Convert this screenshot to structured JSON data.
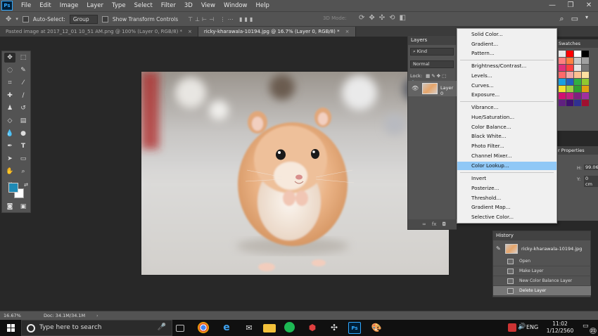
{
  "app": {
    "logo": "Ps"
  },
  "menubar": {
    "items": [
      "File",
      "Edit",
      "Image",
      "Layer",
      "Type",
      "Select",
      "Filter",
      "3D",
      "View",
      "Window",
      "Help"
    ],
    "window_controls": [
      "—",
      "❐",
      "✕"
    ]
  },
  "options": {
    "auto_select_label": "Auto-Select:",
    "auto_select_value": "Group",
    "transform_label": "Show Transform Controls",
    "mode_3d_label": "3D Mode:"
  },
  "tabs": [
    {
      "label": "Pasted image at 2017_12_01 10_51 AM.png @ 100% (Layer 0, RGB/8) *",
      "close": "×"
    },
    {
      "label": "ricky-kharawala-10194.jpg @ 16.7% (Layer 0, RGB/8) *",
      "close": "×"
    }
  ],
  "layers": {
    "title": "Layers",
    "filter_label": "Kind",
    "blend_mode": "Normal",
    "lock_label": "Lock:",
    "layer_name": "Layer 0",
    "footer_icons": [
      "∞",
      "fx",
      "◘"
    ]
  },
  "adjustment_menu": {
    "items": [
      "Solid Color...",
      "Gradient...",
      "Pattern...",
      "Brightness/Contrast...",
      "Levels...",
      "Curves...",
      "Exposure...",
      "Vibrance...",
      "Hue/Saturation...",
      "Color Balance...",
      "Black  White...",
      "Photo Filter...",
      "Channel Mixer...",
      "Color Lookup...",
      "Invert",
      "Posterize...",
      "Threshold...",
      "Gradient Map...",
      "Selective Color..."
    ],
    "highlighted": "Color Lookup..."
  },
  "swatches": {
    "title": "Swatches",
    "colors": [
      "#e8e8e8",
      "#ff0000",
      "#ffffff",
      "#000000",
      "#ff7f7f",
      "#ff8040",
      "#c8c8c8",
      "#a0a0a0",
      "#e0307a",
      "#ff4040",
      "#e6e6e6",
      "#787878",
      "#ff6a6a",
      "#f3a6a6",
      "#ffc090",
      "#ffe0a0",
      "#18a0e0",
      "#2060c0",
      "#30b040",
      "#90c830",
      "#f0e030",
      "#a0d040",
      "#30a030",
      "#e0a010",
      "#d01070",
      "#c02080",
      "#802080",
      "#a030a0",
      "#602080",
      "#401070",
      "#303090",
      "#a01030"
    ]
  },
  "properties": {
    "title": "r Properties",
    "h_label": "H:",
    "h_value": "99.06",
    "y_label": "Y:",
    "y_value": "0 cm"
  },
  "history": {
    "title": "History",
    "snapshot_name": "ricky-kharawala-10194.jpg",
    "items": [
      "Open",
      "Make Layer",
      "New Color Balance Layer",
      "Delete Layer"
    ]
  },
  "status": {
    "zoom": "16.67%",
    "doc_size": "Doc: 34.1M/34.1M",
    "arrow": "›"
  },
  "taskbar": {
    "search_placeholder": "Type here to search",
    "language": "ENG",
    "time": "11:02",
    "date": "1/12/2560",
    "notification_count": "21"
  }
}
